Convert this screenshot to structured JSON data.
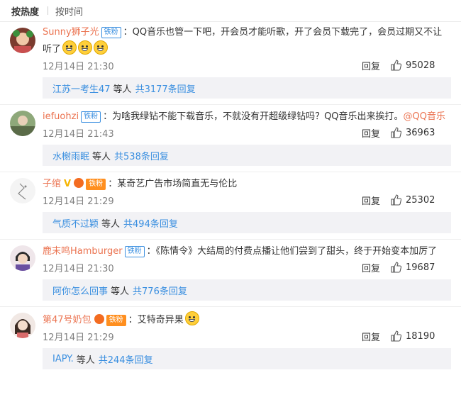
{
  "sort": {
    "hot": "按热度",
    "time": "按时间"
  },
  "reply_label": "回复",
  "suffix_text": "等人",
  "comments": [
    {
      "user": "Sunny狮子光",
      "badge": "铁粉",
      "text_line1": "：QQ音乐也管一下吧，开会员才能听歌，开了会员下载完了，会员过期又不让",
      "text_line2": "听了",
      "time": "12月14日 21:30",
      "likes": "95028",
      "sub_user": "江苏一考生47",
      "sub_total": "共3177条回复"
    },
    {
      "user": "iefuohzi",
      "badge": "铁粉",
      "text_line1": "：为啥我绿钻不能下载音乐，不就没有开超级绿钻吗？QQ音乐出来挨打。",
      "mention": "@QQ音乐",
      "time": "12月14日 21:43",
      "likes": "36963",
      "sub_user": "水榭雨眠",
      "sub_total": "共538条回复"
    },
    {
      "user": "子绾",
      "badge": "铁粉",
      "text_line1": "：某奇艺广告市场简直无与伦比",
      "time": "12月14日 21:29",
      "likes": "25302",
      "sub_user": "气质不过颖",
      "sub_total": "共494条回复"
    },
    {
      "user": "鹿末鸣Hamburger",
      "badge": "铁粉",
      "text_line1": "：《陈情令》大结局的付费点播让他们尝到了甜头，终于开始变本加厉了",
      "time": "12月14日 21:30",
      "likes": "19687",
      "sub_user": "阿你怎么回事",
      "sub_total": "共776条回复"
    },
    {
      "user": "第47号奶包",
      "badge": "铁粉",
      "text_line1": "：艾特奇异果",
      "time": "12月14日 21:29",
      "likes": "18190",
      "sub_user": "IAPY.",
      "sub_total": "共244条回复"
    }
  ]
}
